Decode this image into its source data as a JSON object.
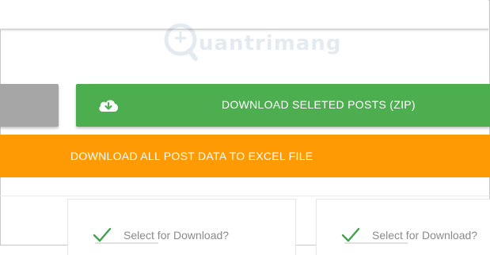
{
  "watermark": {
    "text": "uantrimang"
  },
  "buttons": {
    "download_selected_label": "DOWNLOAD SELETED POSTS (ZIP)",
    "download_all_label": "DOWNLOAD ALL POST DATA TO EXCEL FILE"
  },
  "cards": [
    {
      "select_label": "Select for Download?"
    },
    {
      "select_label": "Select for Download?"
    }
  ],
  "colors": {
    "green": "#4cae4f",
    "orange": "#fe9a04",
    "gray": "#a6a6a6",
    "check_green": "#3fa34d"
  },
  "icons": {
    "download": "cloud-download-icon",
    "check": "checkmark-icon"
  }
}
